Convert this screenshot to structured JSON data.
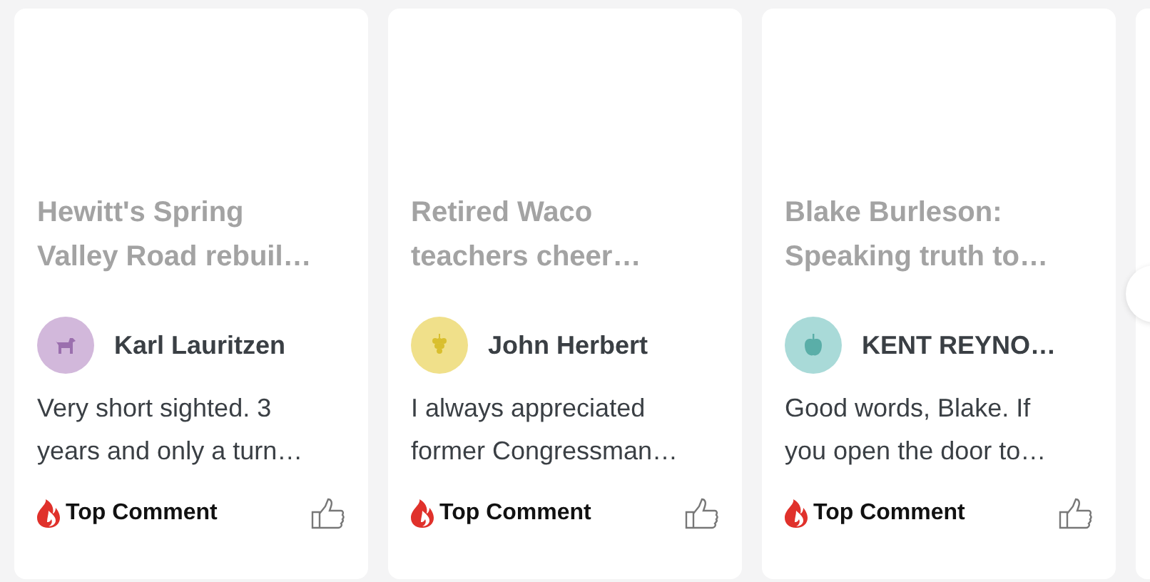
{
  "cards": [
    {
      "headline": "Hewitt's Spring Valley Road rebuil…",
      "author": "Karl Lauritzen",
      "avatar": {
        "kind": "dog",
        "color": "#d2b8db"
      },
      "comment": "Very short sighted. 3 years and only a turn…",
      "badge": "Top Comment"
    },
    {
      "headline": "Retired Waco teachers cheer…",
      "author": "John Herbert",
      "avatar": {
        "kind": "grapes",
        "color": "#f0e08a"
      },
      "comment": "I always appreciated former Congressman…",
      "badge": "Top Comment"
    },
    {
      "headline": "Blake Burleson: Speaking truth to…",
      "author": "KENT REYNO…",
      "avatar": {
        "kind": "apple",
        "color": "#a9dad8"
      },
      "comment": "Good words, Blake. If you open the door to…",
      "badge": "Top Comment"
    }
  ]
}
